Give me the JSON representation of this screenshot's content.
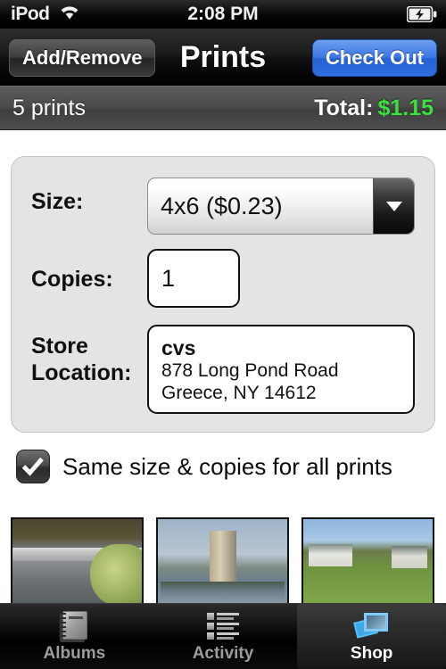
{
  "status_bar": {
    "carrier": "iPod",
    "wifi_icon": "wifi-icon",
    "time": "2:08 PM",
    "battery_icon": "battery-charging-icon"
  },
  "nav_bar": {
    "back_label": "Add/Remove",
    "title": "Prints",
    "checkout_label": "Check Out"
  },
  "sub_bar": {
    "count_label": "5 prints",
    "total_label": "Total:",
    "total_value": "$1.15",
    "total_color": "#3ce03c"
  },
  "options": {
    "size": {
      "label": "Size:",
      "value": "4x6 ($0.23)",
      "caret_icon": "chevron-down-icon"
    },
    "copies": {
      "label": "Copies:",
      "value": "1",
      "placeholder": "1"
    },
    "store": {
      "label": "Store Location:",
      "name": "cvs",
      "address_line1": "878 Long Pond Road",
      "address_line2": "Greece, NY 14612"
    }
  },
  "same_size": {
    "checked": true,
    "check_icon": "checkmark-icon",
    "label": "Same size & copies for all prints"
  },
  "thumbnails": [
    {
      "name": "thumbnail-waterfall"
    },
    {
      "name": "thumbnail-tower"
    },
    {
      "name": "thumbnail-houses"
    }
  ],
  "tab_bar": {
    "items": [
      {
        "label": "Albums",
        "icon": "photo-album-icon",
        "active": false
      },
      {
        "label": "Activity",
        "icon": "activity-list-icon",
        "active": false
      },
      {
        "label": "Shop",
        "icon": "photos-shop-icon",
        "active": true
      }
    ]
  }
}
